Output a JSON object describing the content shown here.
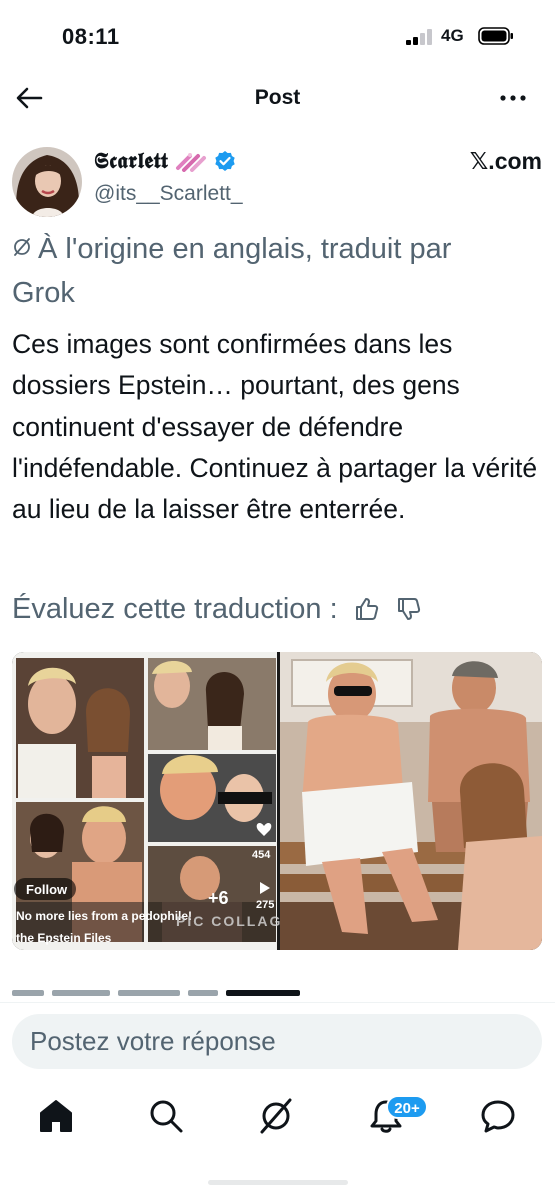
{
  "status_bar": {
    "time": "08:11",
    "network": "4G"
  },
  "header": {
    "title": "Post"
  },
  "author": {
    "display_name": "𝕾𝖈𝖆𝖗𝖑𝖊𝖙𝖙",
    "handle": "@its__Scarlett_",
    "source": "𝕏.com",
    "verified_color": "#1d9bf0"
  },
  "post": {
    "translated_note": "À l'origine en anglais, traduit par Grok",
    "text": "Ces images sont confirmées dans les dossiers Epstein… pourtant, des gens continuent d'essayer de défendre l'indéfendable. Continuez à partager la vérité au lieu de la laisser être enterrée.",
    "rate_translation": "Évaluez cette traduction :"
  },
  "media": {
    "caption_follow": "Follow",
    "caption_main": "No more lies from a pedophile!",
    "caption_source": "the Epstein Files",
    "plus_count": "+6",
    "watermark": "PIC COLLAGE",
    "like_count": "454",
    "share_count": "275"
  },
  "reply": {
    "placeholder": "Postez votre réponse"
  },
  "tabbar": {
    "notifications_badge": "20+",
    "accent": "#1d9bf0"
  }
}
